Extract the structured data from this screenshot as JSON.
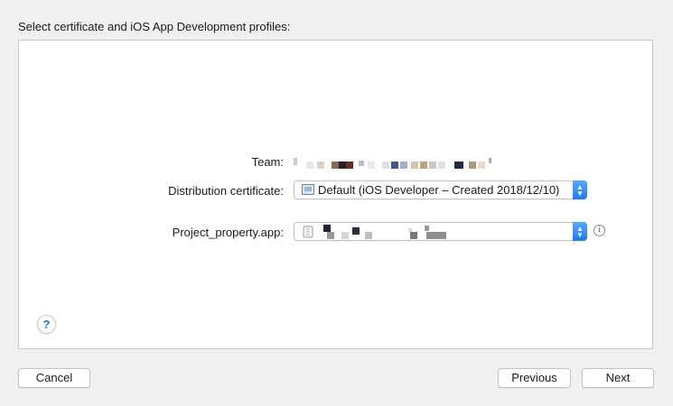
{
  "header": {
    "title": "Select certificate and iOS App Development profiles:"
  },
  "form": {
    "team_label": "Team:",
    "team_value": "█████ 'nAn Technology Co., Ltd",
    "distribution_label": "Distribution certificate:",
    "distribution_value": "Default (iOS Developer – Created 2018/12/10)",
    "app_label": "Project_property.app:",
    "app_value": "",
    "info_icon": "i",
    "popup_arrows": {
      "up": "▲",
      "down": "▼"
    }
  },
  "help": {
    "label": "?"
  },
  "buttons": {
    "cancel": "Cancel",
    "previous": "Previous",
    "next": "Next"
  },
  "colors": {
    "accent": "#1d7cf2",
    "panel": "#ffffff",
    "window": "#f0f0f0"
  }
}
